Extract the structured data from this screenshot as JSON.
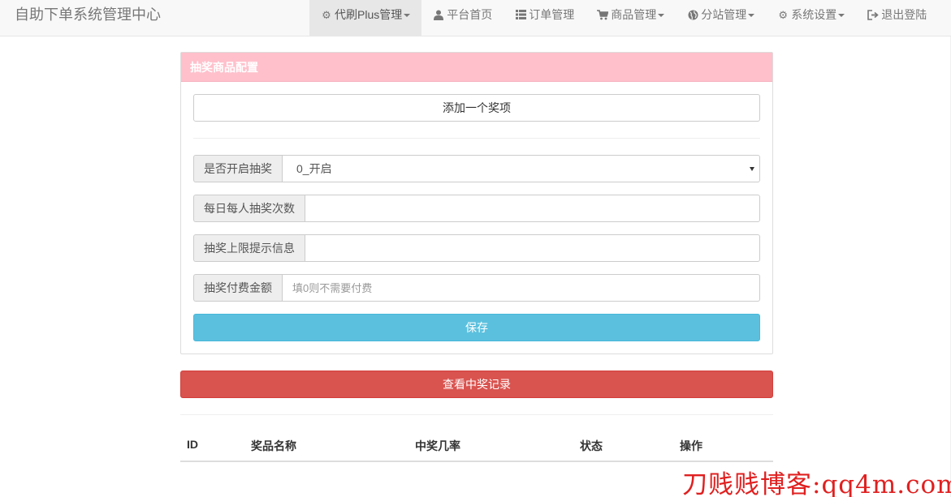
{
  "navbar": {
    "brand": "自助下单系统管理中心",
    "items": [
      {
        "label": "代刷Plus管理",
        "icon": "gear-icon",
        "glyph": "⚙",
        "dropdown": true,
        "active": true
      },
      {
        "label": "平台首页",
        "icon": "user-icon",
        "glyph": "👤",
        "dropdown": false,
        "active": false
      },
      {
        "label": "订单管理",
        "icon": "list-icon",
        "glyph": "☰",
        "dropdown": false,
        "active": false
      },
      {
        "label": "商品管理",
        "icon": "cart-icon",
        "glyph": "🛒",
        "dropdown": true,
        "active": false
      },
      {
        "label": "分站管理",
        "icon": "globe-icon",
        "glyph": "🌐",
        "dropdown": true,
        "active": false
      },
      {
        "label": "系统设置",
        "icon": "cog-icon",
        "glyph": "⚙",
        "dropdown": true,
        "active": false
      },
      {
        "label": "退出登陆",
        "icon": "logout-icon",
        "glyph": "⇥",
        "dropdown": false,
        "active": false
      }
    ]
  },
  "panel": {
    "title": "抽奖商品配置",
    "add_button": "添加一个奖项",
    "fields": {
      "enable": {
        "label": "是否开启抽奖",
        "value": "0_开启"
      },
      "daily_times": {
        "label": "每日每人抽奖次数",
        "value": ""
      },
      "limit_message": {
        "label": "抽奖上限提示信息",
        "value": ""
      },
      "fee": {
        "label": "抽奖付费金额",
        "placeholder": "填0则不需要付费"
      }
    },
    "save_button": "保存"
  },
  "records_button": "查看中奖记录",
  "table": {
    "columns": [
      "ID",
      "奖品名称",
      "中奖几率",
      "状态",
      "操作"
    ]
  },
  "watermark": "刀贱贱博客:qq4m.com",
  "colors": {
    "panel_heading": "#ffc0cb",
    "save_button": "#5bc0de",
    "records_button": "#d9534f",
    "watermark": "#e02020"
  }
}
